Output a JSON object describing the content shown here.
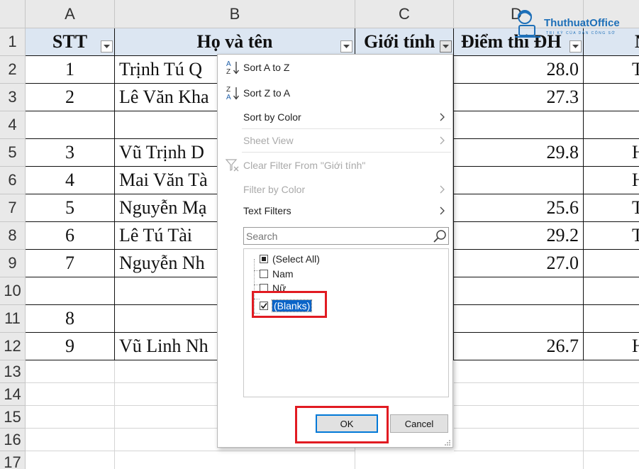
{
  "columns": [
    "A",
    "B",
    "C",
    "D"
  ],
  "rows": [
    "1",
    "2",
    "3",
    "4",
    "5",
    "6",
    "7",
    "8",
    "9",
    "10",
    "11",
    "12",
    "13",
    "14",
    "15",
    "16",
    "17"
  ],
  "header": {
    "stt": "STT",
    "name": "Họ và tên",
    "gender": "Giới tính",
    "score": "Điểm thi ĐH",
    "next": "N"
  },
  "data": [
    {
      "stt": "1",
      "name": "Trịnh Tú Q",
      "score": "28.0",
      "e": "T"
    },
    {
      "stt": "2",
      "name": "Lê Văn Kha",
      "score": "27.3",
      "e": ""
    },
    {
      "stt": "",
      "name": "",
      "score": "",
      "e": ""
    },
    {
      "stt": "3",
      "name": "Vũ Trịnh D",
      "score": "29.8",
      "e": "H"
    },
    {
      "stt": "4",
      "name": "Mai Văn Tà",
      "score": "",
      "e": "H"
    },
    {
      "stt": "5",
      "name": "Nguyễn Mạ",
      "score": "25.6",
      "e": "T"
    },
    {
      "stt": "6",
      "name": "Lê Tú Tài",
      "score": "29.2",
      "e": "T"
    },
    {
      "stt": "7",
      "name": "Nguyễn Nh",
      "score": "27.0",
      "e": ""
    },
    {
      "stt": "",
      "name": "",
      "score": "",
      "e": ""
    },
    {
      "stt": "8",
      "name": "",
      "score": "",
      "e": ""
    },
    {
      "stt": "9",
      "name": "Vũ Linh Nh",
      "score": "26.7",
      "e": "H"
    }
  ],
  "logo": {
    "brand": "ThuthuatOffice",
    "tagline": "TRI KỲ CỦA DÂN CÔNG SỞ"
  },
  "menu": {
    "sort_az": "Sort A to Z",
    "sort_za": "Sort Z to A",
    "sort_color": "Sort by Color",
    "sheet_view": "Sheet View",
    "clear_filter": "Clear Filter From \"Giới tính\"",
    "filter_color": "Filter by Color",
    "text_filters": "Text Filters",
    "search_placeholder": "Search",
    "list": [
      {
        "label": "(Select All)",
        "state": "partial"
      },
      {
        "label": "Nam",
        "state": "unchecked"
      },
      {
        "label": "Nữ",
        "state": "unchecked"
      },
      {
        "label": "(Blanks)",
        "state": "checked"
      }
    ],
    "ok": "OK",
    "cancel": "Cancel"
  },
  "colors": {
    "highlight": "#e11b22",
    "selection": "#0a64c8",
    "header_fill": "#dce6f2"
  }
}
